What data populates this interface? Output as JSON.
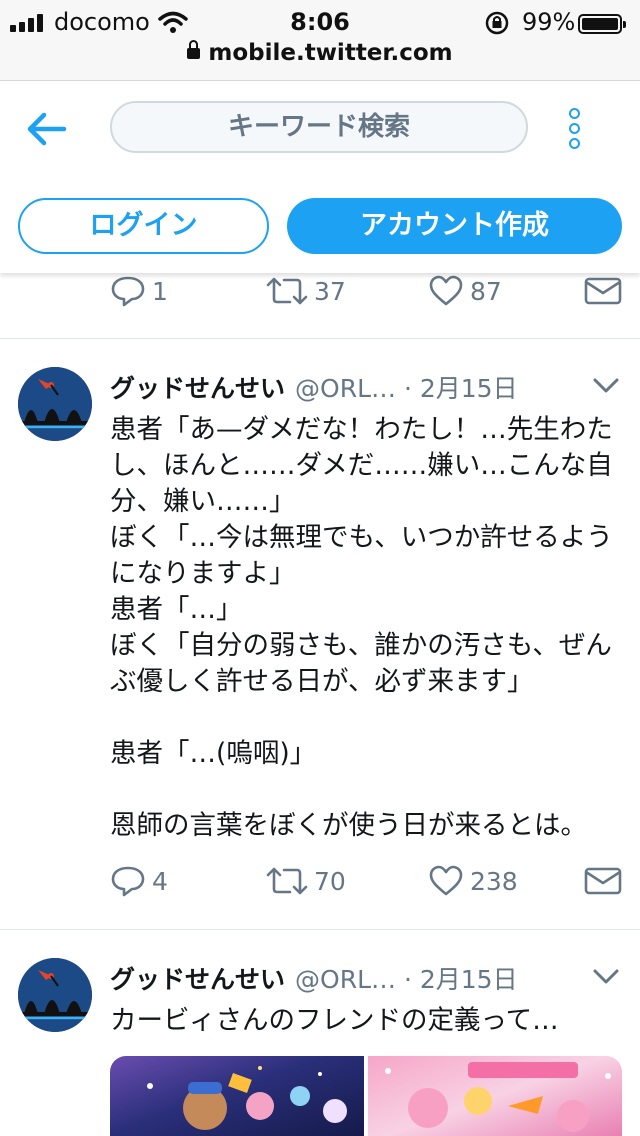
{
  "status": {
    "carrier": "docomo",
    "time": "8:06",
    "battery": "99%",
    "url": "mobile.twitter.com"
  },
  "header": {
    "search_label": "キーワード検索",
    "login_label": "ログイン",
    "signup_label": "アカウント作成"
  },
  "colors": {
    "accent": "#1da1f2",
    "muted": "#657786",
    "text": "#14171a"
  },
  "partial_tweet": {
    "replies": "1",
    "retweets": "37",
    "likes": "87"
  },
  "tweets": [
    {
      "name": "グッドせんせい",
      "handle": "@ORL…",
      "date": "· 2月15日",
      "text": "患者「あ—ダメだな！わたし！…先生わたし、ほんと……ダメだ……嫌い…こんな自分、嫌い……」\nぼく「…今は無理でも、いつか許せるようになりますよ」\n患者「…」\nぼく「自分の弱さも、誰かの汚さも、ぜんぶ優しく許せる日が、必ず来ます」\n\n患者「…(嗚咽)」\n\n恩師の言葉をぼくが使う日が来るとは。",
      "replies": "4",
      "retweets": "70",
      "likes": "238"
    },
    {
      "name": "グッドせんせい",
      "handle": "@ORL…",
      "date": "· 2月15日",
      "text": "カービィさんのフレンドの定義って…"
    }
  ]
}
